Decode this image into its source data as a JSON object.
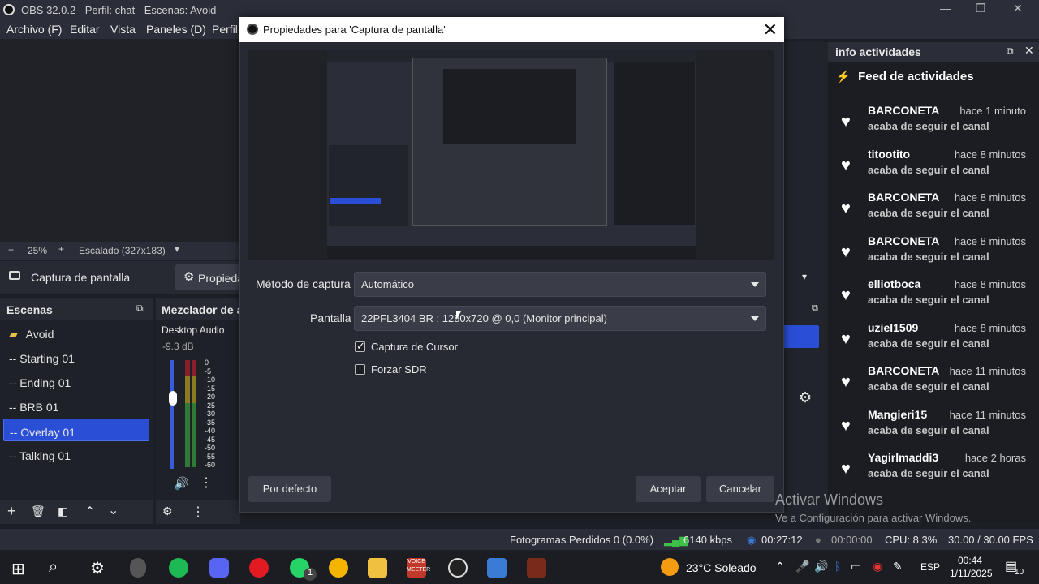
{
  "window": {
    "title": "OBS 32.0.2 - Perfil: chat - Escenas: Avoid"
  },
  "menu": [
    "Archivo (F)",
    "Editar",
    "Vista",
    "Paneles (D)",
    "Perfil"
  ],
  "preview_bar": {
    "zoom": "25%",
    "scaled": "Escalado (327x183)"
  },
  "source": {
    "name": "Captura de pantalla",
    "properties_button": "Propieda"
  },
  "scenes": {
    "title": "Escenas",
    "items": [
      "Avoid",
      "-- Starting 01",
      "-- Ending 01",
      "-- BRB 01",
      "-- Overlay 01",
      "-- Talking 01"
    ],
    "selected_index": 4
  },
  "mixer": {
    "title": "Mezclador de a",
    "channel": "Desktop Audio",
    "db": "-9.3 dB",
    "scale": [
      "0",
      "-5",
      "-10",
      "-15",
      "-20",
      "-25",
      "-30",
      "-35",
      "-40",
      "-45",
      "-50",
      "-55",
      "-60"
    ]
  },
  "dialog": {
    "title": "Propiedades para 'Captura de pantalla'",
    "method_label": "Método de captura",
    "method_value": "Automático",
    "screen_label": "Pantalla",
    "screen_value": "22PFL3404 BR : 1280x720 @ 0,0 (Monitor principal)",
    "cursor_label": "Captura de Cursor",
    "cursor_checked": true,
    "sdr_label": "Forzar SDR",
    "sdr_checked": false,
    "defaults_button": "Por defecto",
    "ok_button": "Aceptar",
    "cancel_button": "Cancelar"
  },
  "activity": {
    "dock_title": "info actividades",
    "feed_title": "Feed de actividades",
    "items": [
      {
        "name": "BARCONETA",
        "time": "hace 1 minuto",
        "action": "acaba de seguir el canal"
      },
      {
        "name": "titootito",
        "time": "hace 8 minutos",
        "action": "acaba de seguir el canal"
      },
      {
        "name": "BARCONETA",
        "time": "hace 8 minutos",
        "action": "acaba de seguir el canal"
      },
      {
        "name": "BARCONETA",
        "time": "hace 8 minutos",
        "action": "acaba de seguir el canal"
      },
      {
        "name": "elliotboca",
        "time": "hace 8 minutos",
        "action": "acaba de seguir el canal"
      },
      {
        "name": "uziel1509",
        "time": "hace 8 minutos",
        "action": "acaba de seguir el canal"
      },
      {
        "name": "BARCONETA",
        "time": "hace 11 minutos",
        "action": "acaba de seguir el canal"
      },
      {
        "name": "Mangieri15",
        "time": "hace 11 minutos",
        "action": "acaba de seguir el canal"
      },
      {
        "name": "Yagirlmaddi3",
        "time": "hace 2 horas",
        "action": "acaba de seguir el canal"
      }
    ]
  },
  "watermark": {
    "line1": "Activar Windows",
    "line2": "Ve a Configuración para activar Windows."
  },
  "status": {
    "dropped": "Fotogramas Perdidos 0 (0.0%)",
    "bitrate": "6140 kbps",
    "stream_time": "00:27:12",
    "rec_time": "00:00:00",
    "cpu": "CPU: 8.3%",
    "fps": "30.00 / 30.00 FPS"
  },
  "taskbar": {
    "weather": "23°C  Soleado",
    "lang": "ESP",
    "time": "00:44",
    "date": "1/11/2025",
    "whatsapp_badge": "1",
    "notif_count": "10",
    "voicemeeter_label": "VOICE\nMEETER"
  },
  "colors": {
    "accent": "#2a4fd6",
    "dialog_bg": "#272a33",
    "panel_bg": "#1f2129"
  }
}
